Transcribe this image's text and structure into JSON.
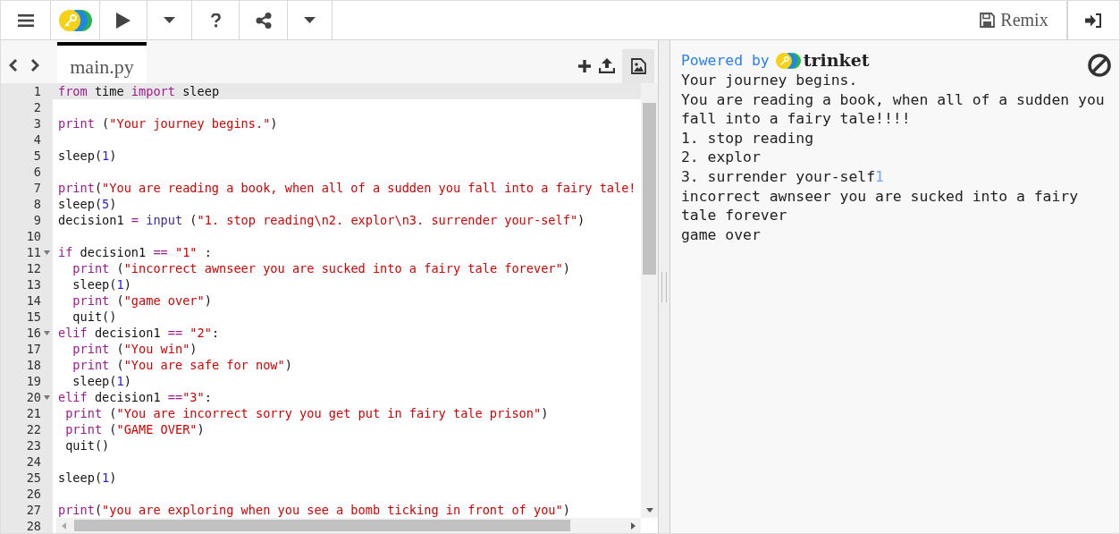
{
  "toolbar": {
    "remix_label": "Remix"
  },
  "editor": {
    "tab": {
      "label": "main.py",
      "selected": true
    },
    "lines": [
      {
        "num": "1",
        "active": true,
        "tokens": [
          {
            "kind": "keyword",
            "text": "from"
          },
          {
            "kind": "plain",
            "text": " time "
          },
          {
            "kind": "keyword",
            "text": "import"
          },
          {
            "kind": "plain",
            "text": " sleep"
          }
        ]
      },
      {
        "num": "2",
        "active": false
      },
      {
        "num": "3",
        "active": false,
        "tokens": [
          {
            "kind": "keyword",
            "text": "print"
          },
          {
            "kind": "plain",
            "text": " ("
          },
          {
            "kind": "string",
            "text": "\"Your journey begins.\""
          },
          {
            "kind": "plain",
            "text": ")"
          }
        ]
      },
      {
        "num": "4",
        "active": false
      },
      {
        "num": "5",
        "active": false,
        "tokens": [
          {
            "kind": "plain",
            "text": "sleep("
          },
          {
            "kind": "number",
            "text": "1"
          },
          {
            "kind": "plain",
            "text": ")"
          }
        ]
      },
      {
        "num": "6",
        "active": false
      },
      {
        "num": "7",
        "active": false,
        "tokens": [
          {
            "kind": "keyword",
            "text": "print"
          },
          {
            "kind": "plain",
            "text": "("
          },
          {
            "kind": "string",
            "text": "\"You are reading a book, when all of a sudden you fall into a fairy tale!"
          }
        ]
      },
      {
        "num": "8",
        "active": false,
        "tokens": [
          {
            "kind": "plain",
            "text": "sleep("
          },
          {
            "kind": "number",
            "text": "5"
          },
          {
            "kind": "plain",
            "text": ")"
          }
        ]
      },
      {
        "num": "9",
        "active": false,
        "tokens": [
          {
            "kind": "plain",
            "text": "decision1 "
          },
          {
            "kind": "operator",
            "text": "="
          },
          {
            "kind": "builtin",
            "text": " input"
          },
          {
            "kind": "plain",
            "text": " ("
          },
          {
            "kind": "string",
            "text": "\"1. stop reading\\n2. explor\\n3. surrender your-self\""
          },
          {
            "kind": "plain",
            "text": ")"
          }
        ]
      },
      {
        "num": "10",
        "active": false
      },
      {
        "num": "11",
        "active": false,
        "fold": true,
        "tokens": [
          {
            "kind": "keyword",
            "text": "if"
          },
          {
            "kind": "plain",
            "text": " decision1 "
          },
          {
            "kind": "operator",
            "text": "=="
          },
          {
            "kind": "string",
            "text": " \"1\""
          },
          {
            "kind": "plain",
            "text": " :"
          }
        ]
      },
      {
        "num": "12",
        "active": false,
        "tokens": [
          {
            "kind": "keyword",
            "text": "  print"
          },
          {
            "kind": "plain",
            "text": " ("
          },
          {
            "kind": "string",
            "text": "\"incorrect awnseer you are sucked into a fairy tale forever\""
          },
          {
            "kind": "plain",
            "text": ")"
          }
        ]
      },
      {
        "num": "13",
        "active": false,
        "tokens": [
          {
            "kind": "plain",
            "text": "  sleep("
          },
          {
            "kind": "number",
            "text": "1"
          },
          {
            "kind": "plain",
            "text": ")"
          }
        ]
      },
      {
        "num": "14",
        "active": false,
        "tokens": [
          {
            "kind": "keyword",
            "text": "  print"
          },
          {
            "kind": "plain",
            "text": " ("
          },
          {
            "kind": "string",
            "text": "\"game over\""
          },
          {
            "kind": "plain",
            "text": ")"
          }
        ]
      },
      {
        "num": "15",
        "active": false,
        "tokens": [
          {
            "kind": "plain",
            "text": "  quit()"
          }
        ]
      },
      {
        "num": "16",
        "active": false,
        "fold": true,
        "tokens": [
          {
            "kind": "keyword",
            "text": "elif"
          },
          {
            "kind": "plain",
            "text": " decision1 "
          },
          {
            "kind": "operator",
            "text": "=="
          },
          {
            "kind": "string",
            "text": " \"2\""
          },
          {
            "kind": "plain",
            "text": ":"
          }
        ]
      },
      {
        "num": "17",
        "active": false,
        "tokens": [
          {
            "kind": "keyword",
            "text": "  print"
          },
          {
            "kind": "plain",
            "text": " ("
          },
          {
            "kind": "string",
            "text": "\"You win\""
          },
          {
            "kind": "plain",
            "text": ")"
          }
        ]
      },
      {
        "num": "18",
        "active": false,
        "tokens": [
          {
            "kind": "keyword",
            "text": "  print"
          },
          {
            "kind": "plain",
            "text": " ("
          },
          {
            "kind": "string",
            "text": "\"You are safe for now\""
          },
          {
            "kind": "plain",
            "text": ")"
          }
        ]
      },
      {
        "num": "19",
        "active": false,
        "tokens": [
          {
            "kind": "plain",
            "text": "  sleep("
          },
          {
            "kind": "number",
            "text": "1"
          },
          {
            "kind": "plain",
            "text": ")"
          }
        ]
      },
      {
        "num": "20",
        "active": false,
        "fold": true,
        "tokens": [
          {
            "kind": "keyword",
            "text": "elif"
          },
          {
            "kind": "plain",
            "text": " decision1 "
          },
          {
            "kind": "operator",
            "text": "=="
          },
          {
            "kind": "string",
            "text": "\"3\""
          },
          {
            "kind": "plain",
            "text": ":"
          }
        ]
      },
      {
        "num": "21",
        "active": false,
        "tokens": [
          {
            "kind": "keyword",
            "text": " print"
          },
          {
            "kind": "plain",
            "text": " ("
          },
          {
            "kind": "string",
            "text": "\"You are incorrect sorry you get put in fairy tale prison\""
          },
          {
            "kind": "plain",
            "text": ")"
          }
        ]
      },
      {
        "num": "22",
        "active": false,
        "tokens": [
          {
            "kind": "keyword",
            "text": " print"
          },
          {
            "kind": "plain",
            "text": " ("
          },
          {
            "kind": "string",
            "text": "\"GAME OVER\""
          },
          {
            "kind": "plain",
            "text": ")"
          }
        ]
      },
      {
        "num": "23",
        "active": false,
        "tokens": [
          {
            "kind": "plain",
            "text": " quit()"
          }
        ]
      },
      {
        "num": "24",
        "active": false
      },
      {
        "num": "25",
        "active": false,
        "tokens": [
          {
            "kind": "plain",
            "text": "sleep("
          },
          {
            "kind": "number",
            "text": "1"
          },
          {
            "kind": "plain",
            "text": ")"
          }
        ]
      },
      {
        "num": "26",
        "active": false
      },
      {
        "num": "27",
        "active": false,
        "tokens": [
          {
            "kind": "keyword",
            "text": "print"
          },
          {
            "kind": "plain",
            "text": "("
          },
          {
            "kind": "string",
            "text": "\"you are exploring when you see a bomb ticking in front of you\""
          },
          {
            "kind": "plain",
            "text": ")"
          }
        ]
      },
      {
        "num": "28",
        "active": false
      }
    ]
  },
  "console": {
    "powered_by": "Powered by",
    "brand": "trinket",
    "output": [
      [
        {
          "kind": "output",
          "text": "Your journey begins."
        }
      ],
      [
        {
          "kind": "output",
          "text": "You are reading a book, when all of a sudden you fall into a fairy tale!!!!"
        }
      ],
      [
        {
          "kind": "output",
          "text": "1. stop reading"
        }
      ],
      [
        {
          "kind": "output",
          "text": "2. explor"
        }
      ],
      [
        {
          "kind": "output",
          "text": "3. surrender your-self"
        },
        {
          "kind": "input",
          "text": "1"
        }
      ],
      [
        {
          "kind": "output",
          "text": "incorrect awnseer you are sucked into a fairy tale forever"
        }
      ],
      [
        {
          "kind": "output",
          "text": "game over"
        }
      ]
    ]
  }
}
